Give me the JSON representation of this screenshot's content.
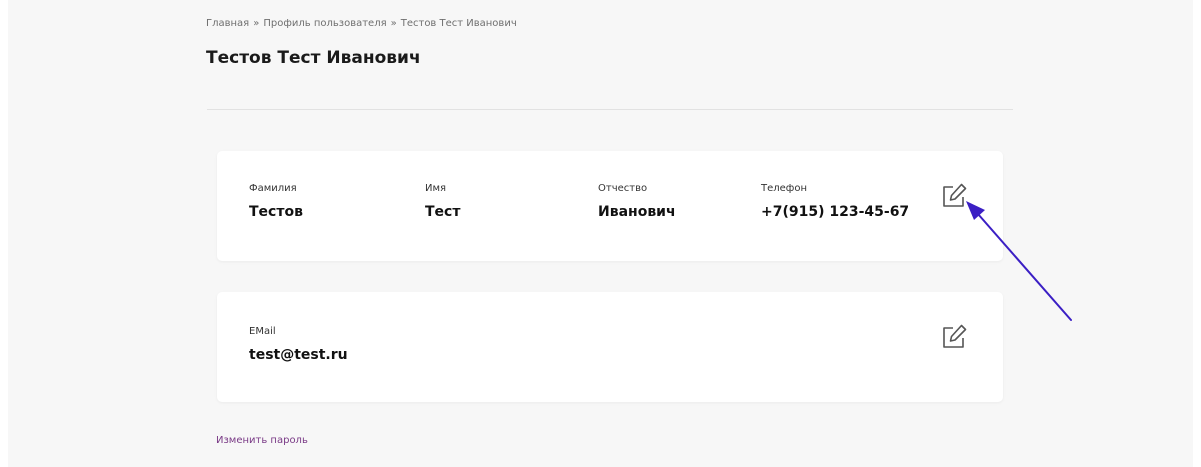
{
  "breadcrumb": {
    "items": [
      "Главная",
      "Профиль пользователя",
      "Тестов Тест Иванович"
    ],
    "separator": "»"
  },
  "page_title": "Тестов Тест Иванович",
  "profile_card": {
    "fields": [
      {
        "label": "Фамилия",
        "value": "Тестов"
      },
      {
        "label": "Имя",
        "value": "Тест"
      },
      {
        "label": "Отчество",
        "value": "Иванович"
      },
      {
        "label": "Телефон",
        "value": "+7(915) 123-45-67"
      }
    ],
    "edit_icon": "edit-icon"
  },
  "email_card": {
    "label": "EMail",
    "value": "test@test.ru",
    "edit_icon": "edit-icon"
  },
  "change_password_link": "Изменить пароль",
  "colors": {
    "page_background": "#f7f7f7",
    "card_background": "#ffffff",
    "link": "#7a3a86",
    "annotation_arrow": "#3b1fc4"
  }
}
